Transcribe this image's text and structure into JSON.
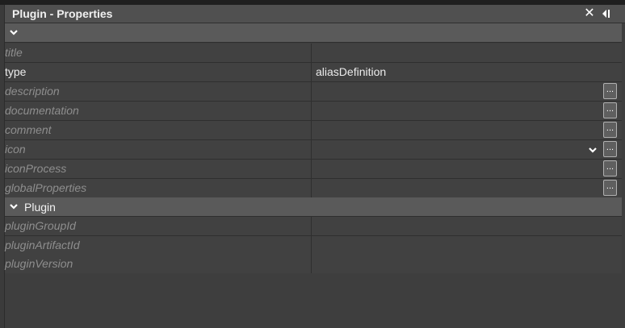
{
  "window": {
    "title": "Plugin - Properties",
    "close_icon": "close-icon",
    "dock_icon": "dock-icon"
  },
  "sections": [
    {
      "label": ""
    },
    {
      "label": "Plugin"
    }
  ],
  "properties": [
    {
      "name": "title",
      "value": "",
      "set": false,
      "button": "none"
    },
    {
      "name": "type",
      "value": "aliasDefinition",
      "set": true,
      "button": "none"
    },
    {
      "name": "description",
      "value": "",
      "set": false,
      "button": "ellipsis"
    },
    {
      "name": "documentation",
      "value": "",
      "set": false,
      "button": "ellipsis"
    },
    {
      "name": "comment",
      "value": "",
      "set": false,
      "button": "ellipsis"
    },
    {
      "name": "icon",
      "value": "",
      "set": false,
      "button": "dropdown+ellipsis"
    },
    {
      "name": "iconProcess",
      "value": "",
      "set": false,
      "button": "ellipsis"
    },
    {
      "name": "globalProperties",
      "value": "",
      "set": false,
      "button": "ellipsis"
    },
    {
      "name": "pluginGroupId",
      "value": "",
      "set": false,
      "button": "none"
    },
    {
      "name": "pluginArtifactId",
      "value": "",
      "set": false,
      "button": "none"
    },
    {
      "name": "pluginVersion",
      "value": "",
      "set": false,
      "button": "none"
    }
  ],
  "ellipsis_label": "...",
  "colors": {
    "panel_bg": "#3e3e3e",
    "titlebar_bg": "#505050",
    "section_bg": "#5a5a5a",
    "unset_text": "#8e8e8e",
    "set_text": "#ececec"
  }
}
